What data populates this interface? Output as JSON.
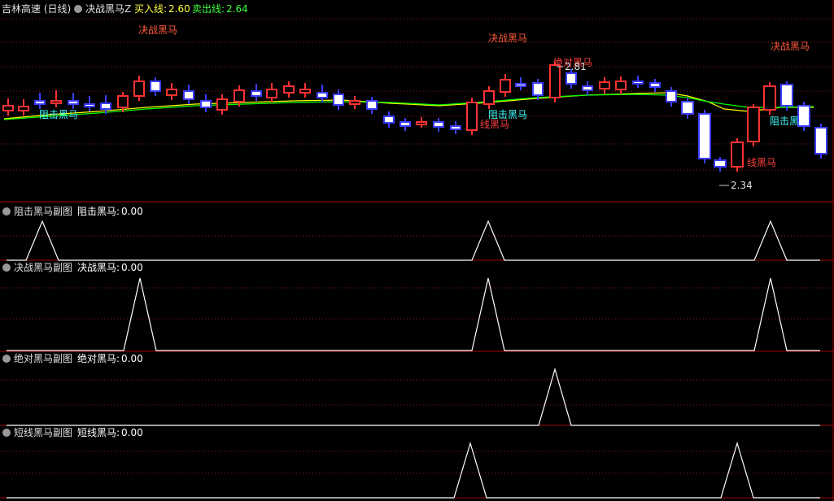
{
  "main": {
    "stock_name": "吉林高速 (日线)",
    "indicator_name": "决战黑马Z",
    "buy_label": "买入线:",
    "buy_value": "2.60",
    "sell_label": "卖出线:",
    "sell_value": "2.64",
    "labels": {
      "jz1": "决战黑马",
      "jz2": "决战黑马",
      "jz3": "决战黑马",
      "zj1": "阻击黑马",
      "zj2": "阻击黑马",
      "zj3": "阻击黑",
      "jd": "绝对黑马",
      "dx1": "线黑马",
      "dx2": "线黑马",
      "high": "2.81",
      "low": "2.34"
    }
  },
  "panels": [
    {
      "name": "阻击黑马副图",
      "series": "阻击黑马:",
      "value": "0.00",
      "peaks": [
        52,
        600,
        947
      ]
    },
    {
      "name": "决战黑马副图",
      "series": "决战黑马:",
      "value": "0.00",
      "peaks": [
        172,
        600,
        947
      ]
    },
    {
      "name": "绝对黑马副图",
      "series": "绝对黑马:",
      "value": "0.00",
      "peaks": [
        682
      ]
    },
    {
      "name": "短线黑马副图",
      "series": "短线黑马:",
      "value": "0.00",
      "peaks": [
        578,
        906
      ]
    }
  ],
  "colors": {
    "up": "#ff3232",
    "down": "#3c3cff",
    "ma1": "#ffff00",
    "ma2": "#00ff00",
    "border": "#8b0000",
    "grid": "#8b1a1a",
    "label_red": "#ff4040",
    "label_cyan": "#40ffff"
  }
}
